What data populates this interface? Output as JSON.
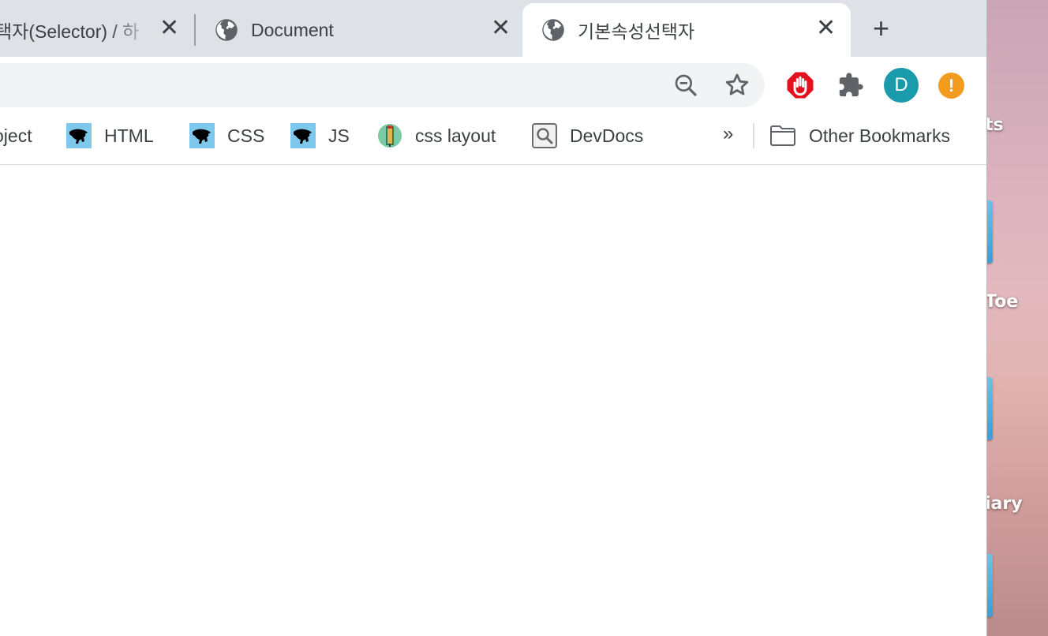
{
  "tabs": [
    {
      "title": "택자(Selector) / 하",
      "close": "✕"
    },
    {
      "title": "Document",
      "close": "✕"
    },
    {
      "title": "기본속성선택자",
      "close": "✕"
    }
  ],
  "new_tab_label": "+",
  "toolbar": {
    "icons": [
      "zoom-out-icon",
      "bookmark-star-icon",
      "adblock-icon",
      "extensions-icon"
    ],
    "avatar_letter": "D",
    "alert_glyph": "!"
  },
  "bookmarks": [
    {
      "label": "oject",
      "icon": "bookmark-icon"
    },
    {
      "label": "HTML",
      "icon": "panther-icon"
    },
    {
      "label": "CSS",
      "icon": "panther-icon"
    },
    {
      "label": "JS",
      "icon": "panther-icon"
    },
    {
      "label": "css layout",
      "icon": "pencil-icon"
    },
    {
      "label": "DevDocs",
      "icon": "magnifier-icon"
    },
    {
      "label": "Other Bookmarks",
      "icon": "folder-icon"
    }
  ],
  "bookmarks_overflow": "»",
  "desktop_labels": [
    "ts",
    "Toe",
    "iary"
  ],
  "colors": {
    "tabstrip": "#dee1e6",
    "omnibox": "#f1f3f4",
    "avatar": "#1a9bab",
    "alert": "#f29b1d",
    "adblock": "#e1121e",
    "bookmark_tile": "#7ec8ec"
  }
}
